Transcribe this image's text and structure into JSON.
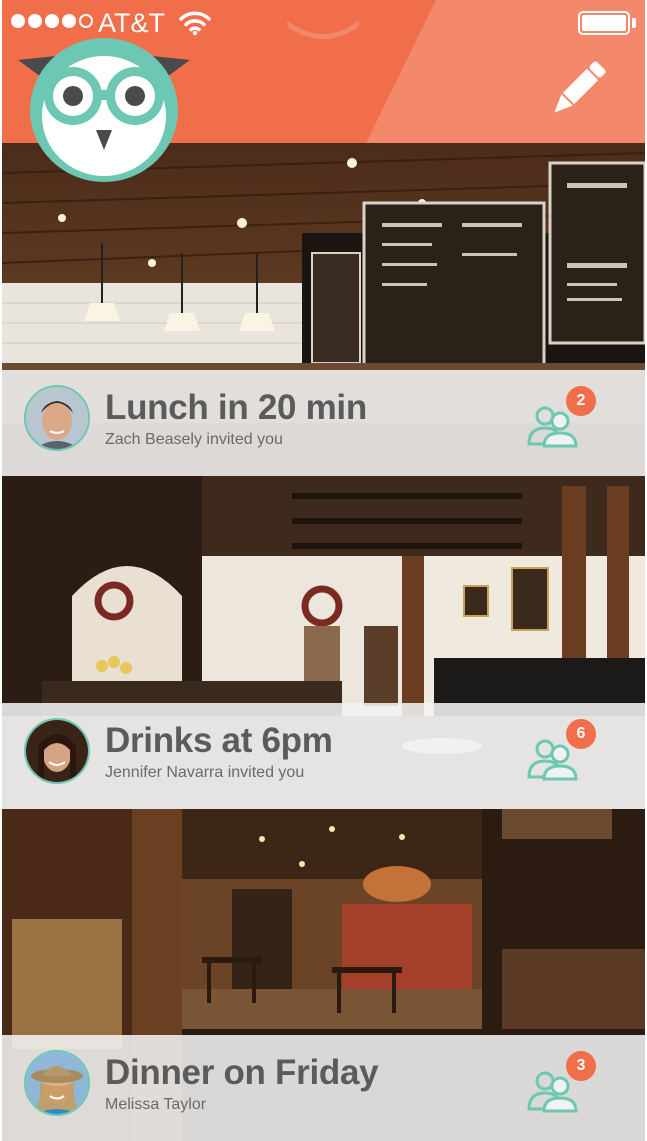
{
  "status_bar": {
    "carrier": "AT&T",
    "signal_bars": 5,
    "signal_filled": 4,
    "icons": [
      "signal-dots-icon",
      "wifi-icon",
      "battery-icon"
    ]
  },
  "header": {
    "logo_icon": "owl-logo-icon",
    "edit_icon": "pencil-icon",
    "accent_color": "#f16e4b"
  },
  "events": [
    {
      "title": "Lunch in 20 min",
      "subtitle": "Zach Beasely invited you",
      "count": "2",
      "icon": "group-icon"
    },
    {
      "title": "Drinks at 6pm",
      "subtitle": "Jennifer Navarra invited you",
      "count": "6",
      "icon": "group-icon"
    },
    {
      "title": "Dinner on Friday",
      "subtitle": "Melissa Taylor",
      "count": "3",
      "icon": "group-icon"
    }
  ],
  "colors": {
    "accent": "#f16e4b",
    "teal": "#6cc8b3",
    "text": "#5b5b5b"
  }
}
